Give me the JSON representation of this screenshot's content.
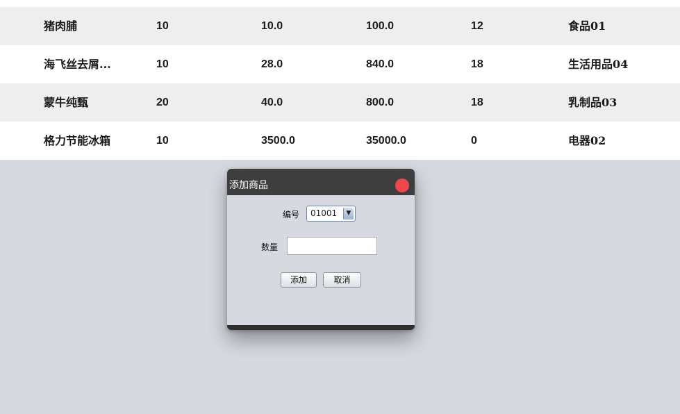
{
  "table": {
    "rows": [
      {
        "name": "猪肉脯",
        "c1": "10",
        "c2": "10.0",
        "c3": "100.0",
        "c4": "12",
        "c5": "食品01"
      },
      {
        "name": "海飞丝去屑...",
        "c1": "10",
        "c2": "28.0",
        "c3": "840.0",
        "c4": "18",
        "c5": "生活用品04"
      },
      {
        "name": "蒙牛纯甄",
        "c1": "20",
        "c2": "40.0",
        "c3": "800.0",
        "c4": "18",
        "c5": "乳制品03"
      },
      {
        "name": "格力节能冰箱",
        "c1": "10",
        "c2": "3500.0",
        "c3": "35000.0",
        "c4": "0",
        "c5": "电器02"
      }
    ]
  },
  "dialog": {
    "title": "添加商品",
    "id_label": "编号",
    "id_value": "01001",
    "qty_label": "数量",
    "qty_value": "",
    "add_label": "添加",
    "cancel_label": "取消",
    "close_color": "#f0474c"
  },
  "colors": {
    "backdrop": "#d6d9e0",
    "row_odd": "#eeeeee",
    "row_even": "#ffffff",
    "titlebar": "#3e3e3e"
  }
}
